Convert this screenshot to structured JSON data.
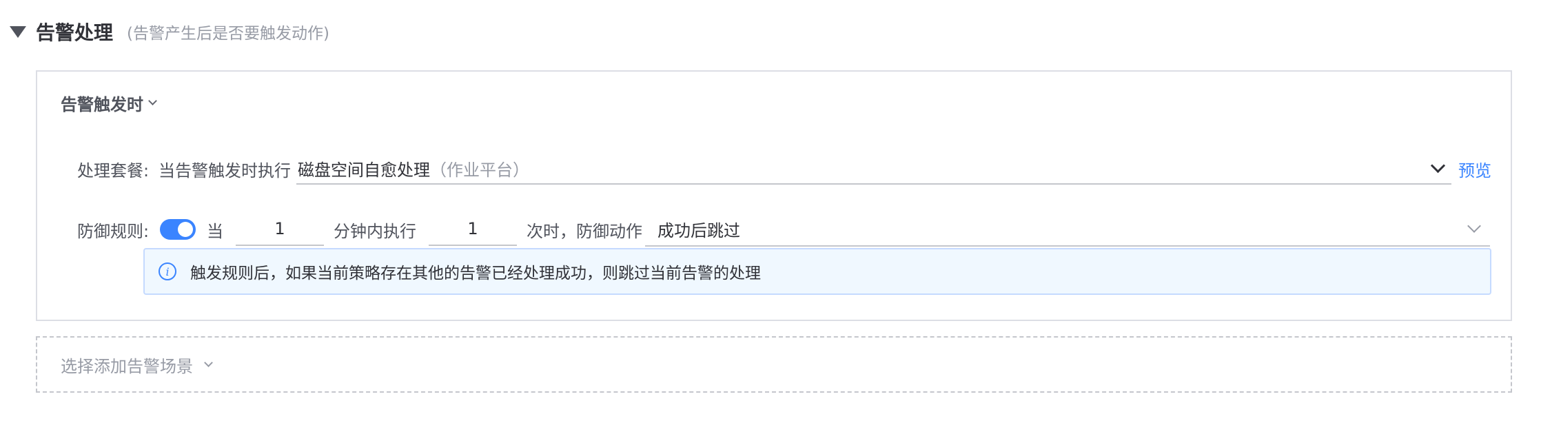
{
  "section": {
    "title": "告警处理",
    "subtitle": "(告警产生后是否要触发动作)"
  },
  "card": {
    "trigger_label": "告警触发时",
    "plan": {
      "label": "处理套餐:",
      "prefix": "当告警触发时执行",
      "selected_name": "磁盘空间自愈处理",
      "selected_suffix": "（作业平台）",
      "preview_label": "预览"
    },
    "defense": {
      "label": "防御规则:",
      "enabled": true,
      "when_text": "当",
      "minutes_value": "1",
      "minutes_text": "分钟内执行",
      "times_value": "1",
      "times_text": "次时，防御动作",
      "action_value": "成功后跳过"
    },
    "alert_info": "触发规则后，如果当前策略存在其他的告警已经处理成功，则跳过当前告警的处理"
  },
  "add_scene": {
    "label": "选择添加告警场景"
  },
  "colors": {
    "primary": "#3a84ff",
    "info_bg": "#f0f8ff",
    "border": "#dcdee5",
    "muted_text": "#979ba5"
  },
  "icons": {
    "section_toggle": "caret-down-icon",
    "info": "info-circle-icon",
    "select_arrow": "chevron-down-icon"
  }
}
